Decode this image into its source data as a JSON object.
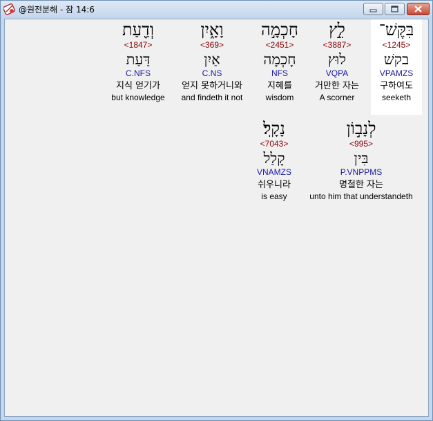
{
  "window": {
    "title": "@원전분해 - 잠 14:6",
    "icon": "app-logo-icon",
    "controls": [
      "minimize-icon",
      "maximize-icon",
      "close-icon"
    ]
  },
  "colors": {
    "strong_number": "#8b0000",
    "parsing": "#1a1aa0",
    "highlight_background": "#ffffff"
  },
  "words": [
    {
      "hebrew": "בִּקֶּשׁ־",
      "strong": "<1245>",
      "lemma": "בקשׁ",
      "parsing": "VPAMZS",
      "korean": "구하여도",
      "english": "seeketh",
      "highlighted": true
    },
    {
      "hebrew": "לֵ֣ץ",
      "strong": "<3887>",
      "lemma": "לוּץ",
      "parsing": "VQPA",
      "korean": "거만한 자는",
      "english": "A scorner",
      "highlighted": false
    },
    {
      "hebrew": "חָכְמָ֣ה",
      "strong": "<2451>",
      "lemma": "חָכְמָה",
      "parsing": "NFS",
      "korean": "지혜를",
      "english": "wisdom",
      "highlighted": false
    },
    {
      "hebrew": "וָאָ֑יִן",
      "strong": "<369>",
      "lemma": "אַיִן",
      "parsing": "C.NS",
      "korean": "얻지 못하거니와",
      "english": "and findeth it not",
      "highlighted": false
    },
    {
      "hebrew": "וְדַ֖עַת",
      "strong": "<1847>",
      "lemma": "דַּעַת",
      "parsing": "C.NFS",
      "korean": "지식 얻기가",
      "english": "but knowledge",
      "highlighted": false
    },
    {
      "hebrew": "לְנָב֣וֹן",
      "strong": "<995>",
      "lemma": "בִּין",
      "parsing": "P.VNPPMS",
      "korean": "명철한 자는",
      "english": "unto him that understandeth",
      "highlighted": false
    },
    {
      "hebrew": "נָקָֽל׃",
      "strong": "<7043>",
      "lemma": "קָלַל",
      "parsing": "VNAMZS",
      "korean": "쉬우니라",
      "english": "is easy",
      "highlighted": false
    }
  ]
}
